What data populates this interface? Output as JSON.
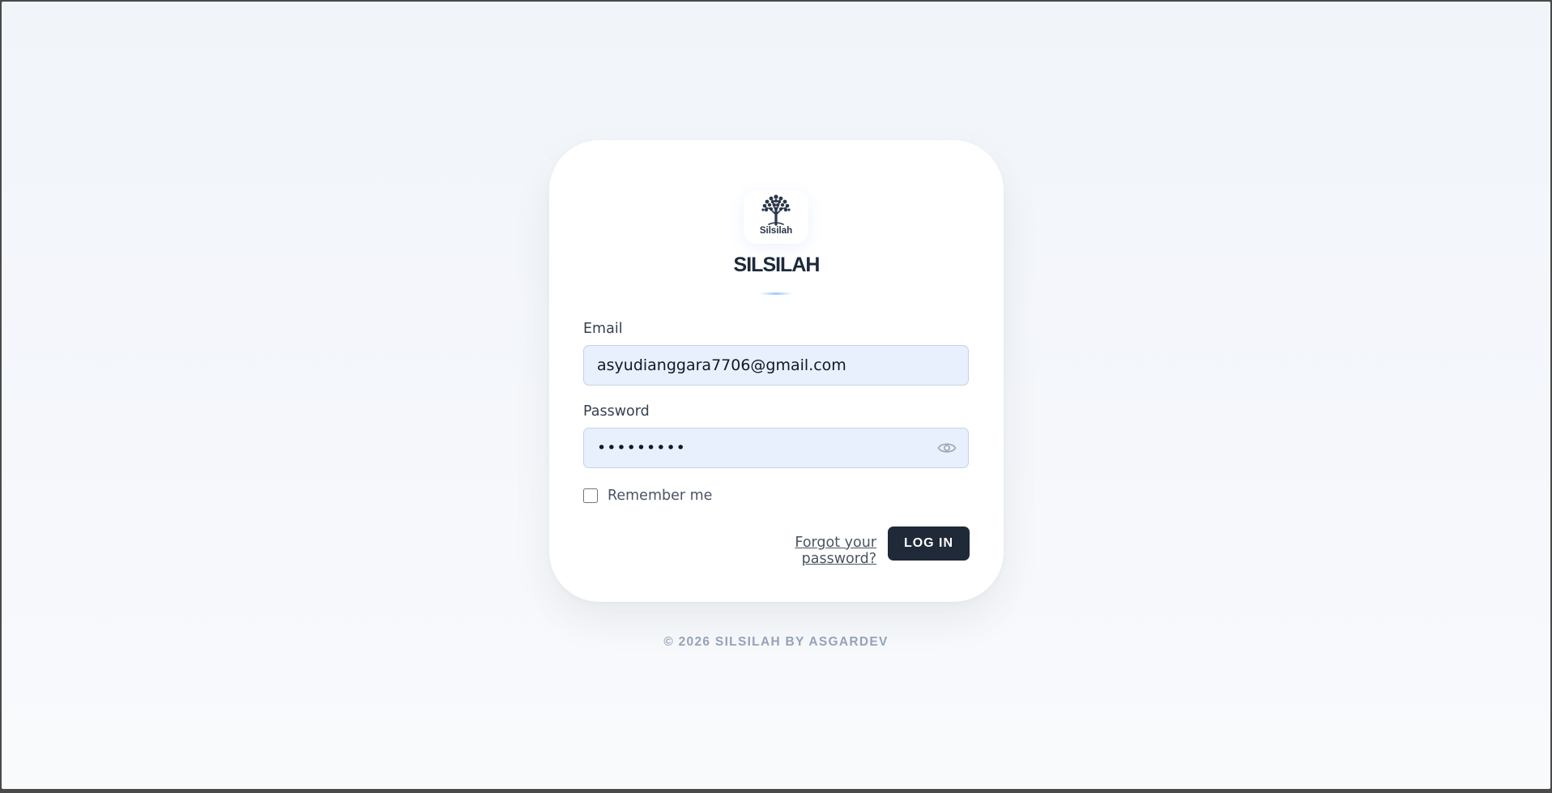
{
  "brand": {
    "logo_text": "Silsilah",
    "logo_icon": "tree-icon",
    "title": "SILSILAH"
  },
  "form": {
    "email_label": "Email",
    "email_value": "asyudianggara7706@gmail.com",
    "password_label": "Password",
    "password_value": "•••••••••",
    "show_password_icon": "eye-icon",
    "remember_label": "Remember me",
    "remember_checked": false,
    "forgot_label": "Forgot your password?",
    "login_label": "LOG IN"
  },
  "footer": {
    "text": "© 2026 SILSILAH BY ASGARDEV"
  },
  "colors": {
    "primary_button": "#1f2937",
    "input_background": "#e8f0fe",
    "title": "#1e293b",
    "footer_text": "#94a3b8"
  }
}
